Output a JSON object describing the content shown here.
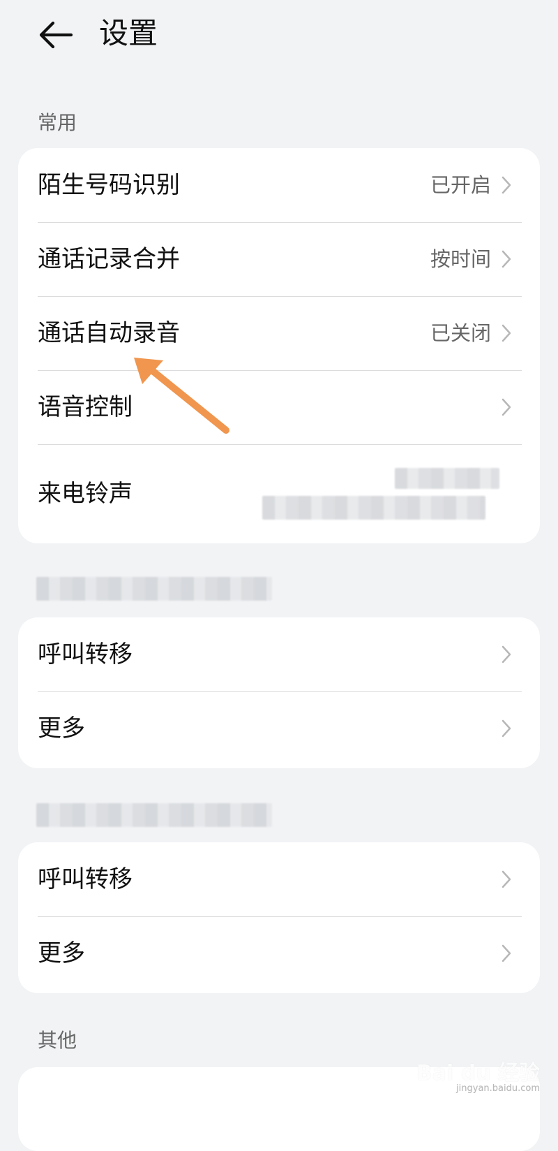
{
  "header": {
    "title": "设置",
    "back_icon": "arrow-left-icon"
  },
  "sections": [
    {
      "label": "常用",
      "rows": [
        {
          "label": "陌生号码识别",
          "value": "已开启"
        },
        {
          "label": "通话记录合并",
          "value": "按时间"
        },
        {
          "label": "通话自动录音",
          "value": "已关闭"
        },
        {
          "label": "语音控制",
          "value": ""
        },
        {
          "label": "来电铃声",
          "value": ""
        }
      ]
    },
    {
      "label": "",
      "rows": [
        {
          "label": "呼叫转移",
          "value": ""
        },
        {
          "label": "更多",
          "value": ""
        }
      ]
    },
    {
      "label": "",
      "rows": [
        {
          "label": "呼叫转移",
          "value": ""
        },
        {
          "label": "更多",
          "value": ""
        }
      ]
    },
    {
      "label": "其他",
      "rows": []
    }
  ],
  "watermark": {
    "main": "Bai du 经验",
    "sub": "jingyan.baidu.com"
  },
  "colors": {
    "background": "#f1f3f5",
    "card": "#ffffff",
    "arrow": "#f0964e",
    "secondary_text": "#666666"
  }
}
